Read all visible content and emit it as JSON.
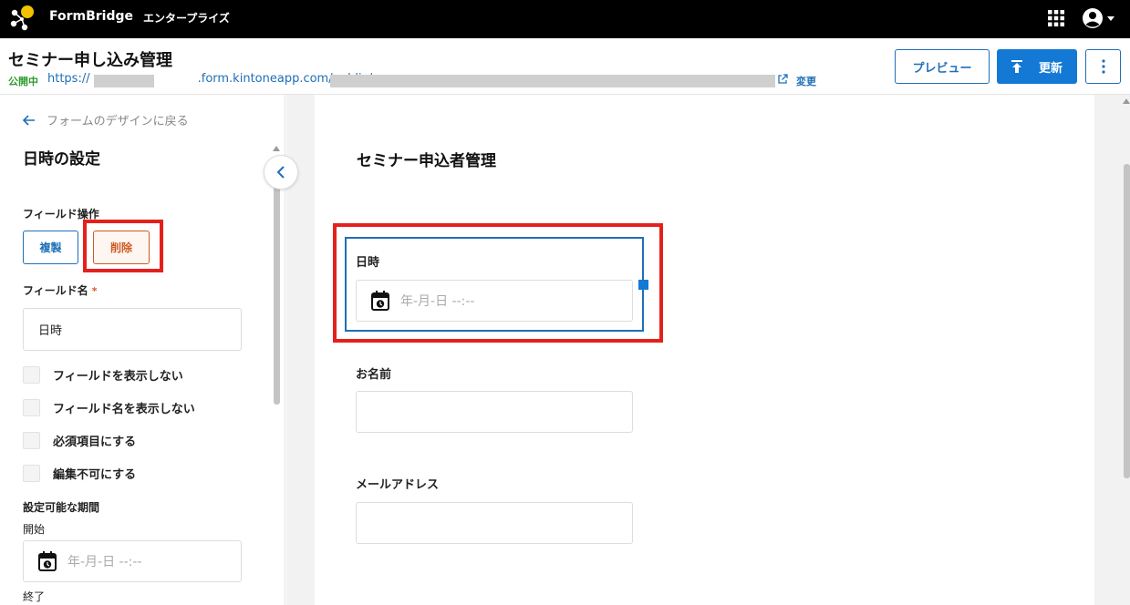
{
  "topbar": {
    "brand": "FormBridge",
    "edition": "エンタープライズ"
  },
  "header": {
    "title": "セミナー申し込み管理",
    "status": "公開中",
    "url_prefix": "https://",
    "url_middle": ".form.kintoneapp.com/public/",
    "change_label": "変更",
    "preview_label": "プレビュー",
    "update_label": "更新"
  },
  "left_panel": {
    "back_label": "フォームのデザインに戻る",
    "title": "日時の設定",
    "field_ops_label": "フィールド操作",
    "duplicate_label": "複製",
    "delete_label": "削除",
    "field_name_label": "フィールド名",
    "required_mark": "*",
    "field_name_value": "日時",
    "checkboxes": [
      {
        "label": "フィールドを表示しない",
        "checked": false
      },
      {
        "label": "フィールド名を表示しない",
        "checked": false
      },
      {
        "label": "必須項目にする",
        "checked": false
      },
      {
        "label": "編集不可にする",
        "checked": false
      }
    ],
    "period_label": "設定可能な期間",
    "start_label": "開始",
    "start_placeholder": "年-月-日 --:--",
    "end_label": "終了"
  },
  "form": {
    "title": "セミナー申込者管理",
    "fields": [
      {
        "label": "日時",
        "type": "datetime",
        "placeholder": "年-月-日 --:--"
      },
      {
        "label": "お名前",
        "type": "text",
        "value": ""
      },
      {
        "label": "メールアドレス",
        "type": "text",
        "value": ""
      }
    ]
  },
  "colors": {
    "topbar": "#000000",
    "primary": "#1479d4",
    "delete": "#d05a22",
    "highlight": "#e5201c",
    "status": "#2e9a2e"
  },
  "icons": [
    "formbridge-logo-icon",
    "apps-grid-icon",
    "account-icon",
    "external-link-icon",
    "upload-icon",
    "more-vert-icon",
    "arrow-left-icon",
    "chevron-left-icon",
    "calendar-icon"
  ]
}
